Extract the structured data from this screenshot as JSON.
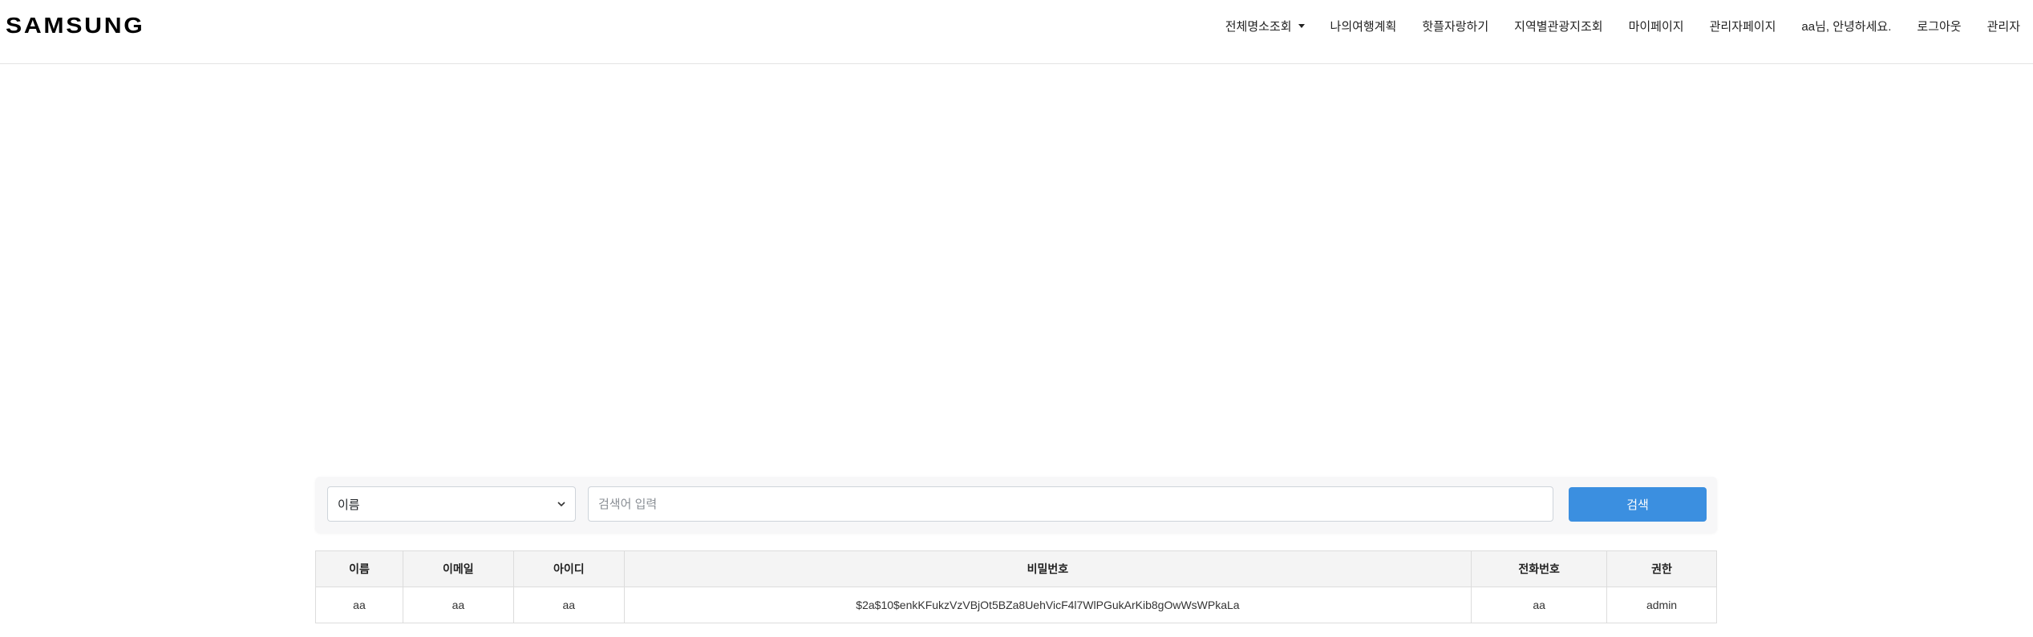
{
  "header": {
    "brand": "SAMSUNG",
    "nav": [
      {
        "label": "전체명소조회",
        "has_dropdown": true
      },
      {
        "label": "나의여행계획"
      },
      {
        "label": "핫플자랑하기"
      },
      {
        "label": "지역별관광지조회"
      },
      {
        "label": "마이페이지"
      },
      {
        "label": "관리자페이지"
      },
      {
        "label": "aa님, 안녕하세요."
      },
      {
        "label": "로그아웃"
      },
      {
        "label": "관리자"
      }
    ]
  },
  "search": {
    "select_value": "이름",
    "placeholder": "검색어 입력",
    "button_label": "검색"
  },
  "table": {
    "columns": [
      "이름",
      "이메일",
      "아이디",
      "비밀번호",
      "전화번호",
      "권한"
    ],
    "rows": [
      [
        "aa",
        "aa",
        "aa",
        "$2a$10$enkKFukzVzVBjOt5BZa8UehVicF4l7WlPGukArKib8gOwWsWPkaLa",
        "aa",
        "admin"
      ]
    ]
  },
  "colors": {
    "primary_button": "#3b8fe0",
    "header_border": "#e3e3e3",
    "table_header_bg": "#f4f4f4"
  }
}
